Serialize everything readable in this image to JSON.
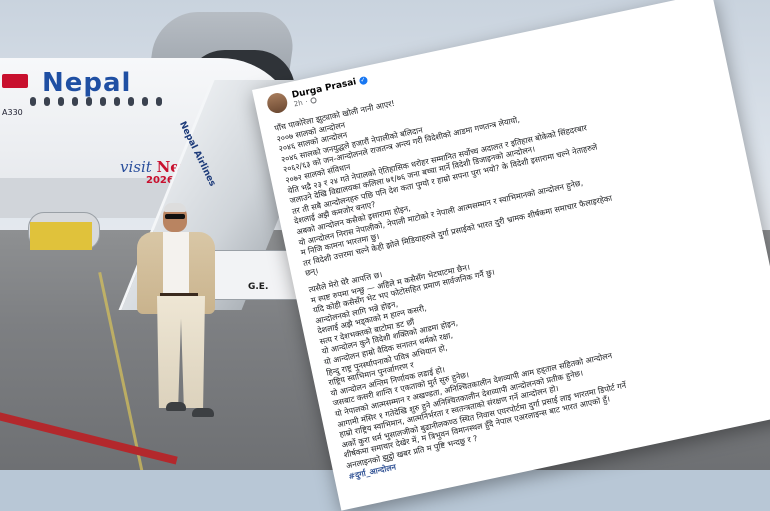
{
  "photo": {
    "airline_name": "Nepal",
    "aircraft_model": "A330",
    "visit_text": "visit",
    "visit_brand": "Nepal",
    "visit_year": "2026",
    "stairs_label": "Nepal Airlines",
    "vehicle_label": "G.E."
  },
  "post": {
    "author": "Durga Prasai",
    "time": "2h",
    "lines": [
      "पाँच पाकोरेला झुट्याको खोली नानी आएर!",
      "२००७ सालको आन्दोलन",
      "२०४६ सालको आन्दोलन",
      "२०४६ सालको जनयुद्धले हजारौं नेपालीको बलिदान",
      "२०६२/६३ को जन-आन्दोलनले राजतन्त्र अन्त्य गरी विदेशीको आडमा गणतन्त्र लेयायो,",
      "२०७२ सालको संविधान",
      "येति भद्रै २३ र २४ गते नेपालको ऐतिहासिक धरोहर सम्मानित सर्वोच्च अदालत र इतिहास बोकेको सिंहदरबार",
      "जलाउने देखि विद्यालयका कलिला ७१/७६ जना बच्चा मार्ने विदेशी डिजाइनको आन्दोलन।",
      "तर ती सबै आन्दोलनहरु पछि पनि देश कता पुग्यो र हाम्रो सपना पुरा भयो? के विदेशी इसारामा चल्ने नेताहरुले",
      "देशलाई अझै कमजोर बनाए?",
      "अबको आन्दोलन कसैको इसारामा होइन,",
      "यो आन्दोलन निरास नेपालीको, नेपाली माटोको र नेपाली आत्मसम्मान र स्वाभिमानको आन्दोलन हुनेछ,",
      "म निजि कामना भारतमा छु।",
      "तर विदेशी उत्तरमा चल्ने केही झोले मिडियाहरुले दुर्गा प्रसाईको भारत दुरी भ्रामक शीर्षकमा समाचार फैलाइरहेका",
      "छन्।",
      "त्यसैले मेरो घेरै आपत्ति छ।",
      "म स्पष्ट रुपमा भन्छु — अहिले म कसैसँग भेटघाटमा छैन।",
      "यदि कोही कसैसँग भेट भए फोटोसहित प्रमाण सार्वजनिक गर्नै छु।",
      "आन्दोलनको लागि भन्ने होइन,",
      "देशलाई अझै भड्काको म हाल्न कसरी,",
      "सत्य र देशभक्तको बाटोमा डट छौं",
      "यो आन्दोलन कुनै विदेशी शक्तिको आडमा होइन,",
      "यो आन्दोलन हाम्रो वैदिक सनातन धर्मको रक्षा,",
      "हिन्दु राष्ट्र पुनर्स्थापनाको पवित्र अभियान हो,",
      "राष्ट्रिय स्वाभिमान पुनर्जागरण र",
      "यो आन्दोलन अन्तिम निर्णायक लडाई हो।",
      "जसबाट कसरी शान्ति र एकताको मुर्त सुरु हुनेछ।",
      "यो नेपालको आत्मसम्मान र अखण्डता, अनिश्चितकालीन देशव्यापी आम हड्ताल सहितको आन्दोलन",
      "आगामी मंसिर १ गतेदेखि शुरु हुने अनिश्चितकालीन देशव्यापी आन्दोलनको प्रतीक हुनेछ।",
      "हाम्रो राष्ट्रिय स्वाभिमान, आत्मनिर्भरता र स्वतन्त्रताको संरक्षण गर्ने आन्दोलन हो।",
      "अर्को कुरा धर्म भुसालजीको बुढानीलकण्ठ स्थित निवास एयरपोर्टमा दुर्गा प्रसाई लाइ भारतमा डिपोर्ट गर्ने",
      "शीर्षकमा समाचार देखेर में, म त्रिभुवन विमानस्थल हुँदै नेपाल एअरलाइन्स बाट भारत आएको हुँ।",
      "अनलाइनको झुट्ठो खबर प्रति म पुष्टि भन्दछु र ?"
    ],
    "tag": "#दुर्गा_आन्दोलन"
  }
}
